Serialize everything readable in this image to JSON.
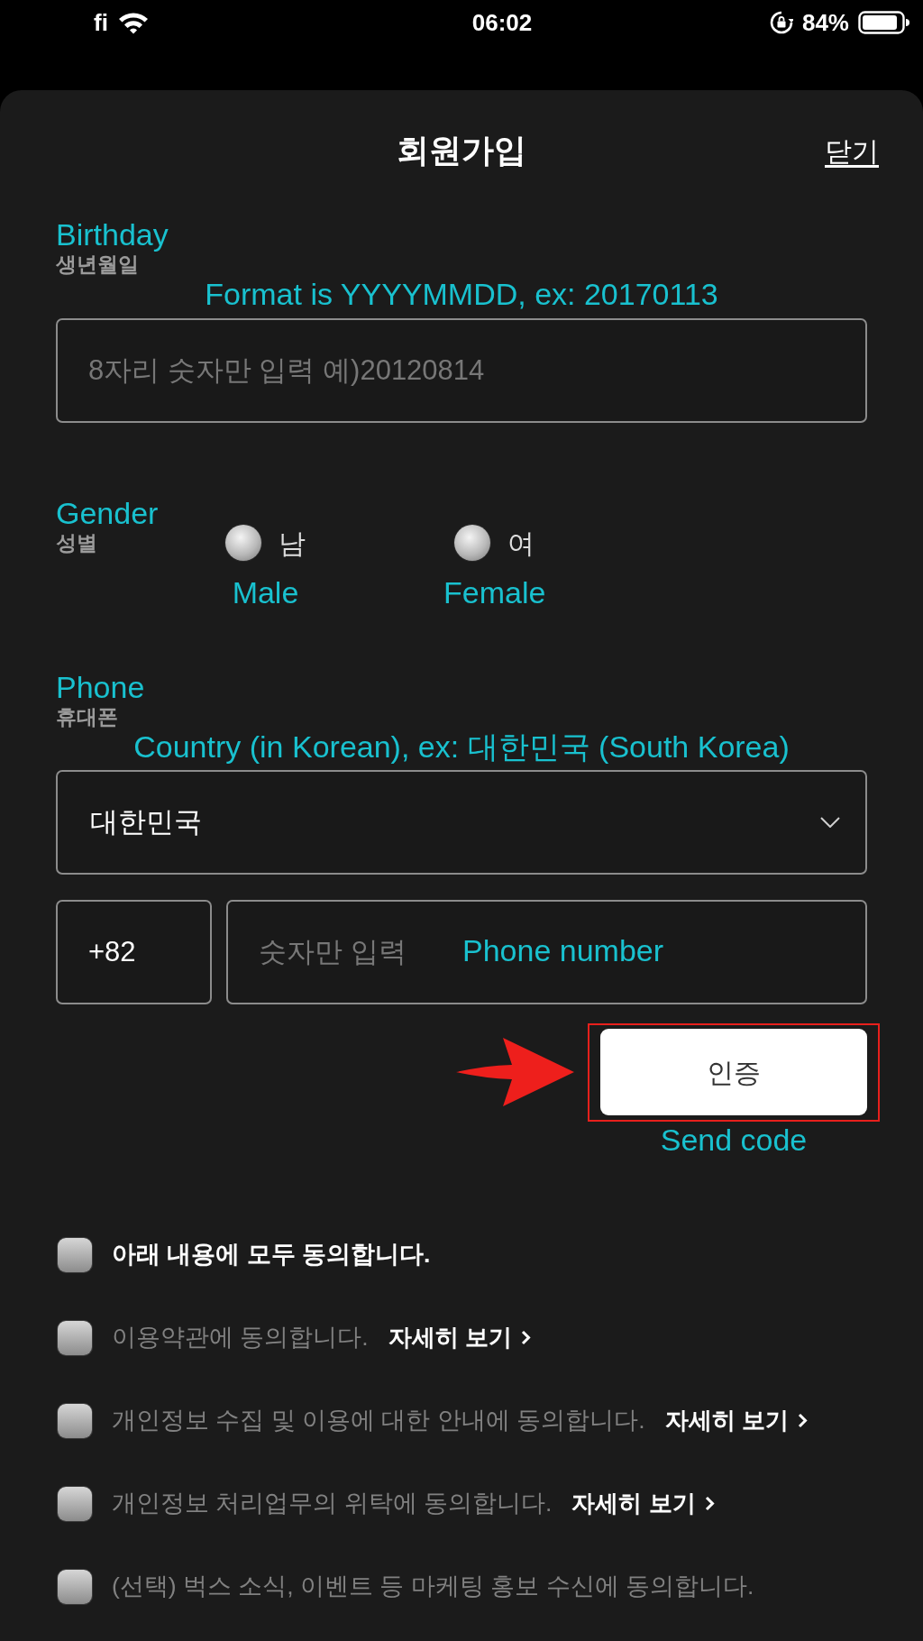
{
  "status_bar": {
    "carrier": "fi",
    "time": "06:02",
    "battery": "84%"
  },
  "sheet": {
    "title": "회원가입",
    "close": "닫기"
  },
  "birthday": {
    "annotation": "Birthday",
    "label": "생년월일",
    "format_annotation": "Format is YYYYMMDD, ex: 20170113",
    "placeholder": "8자리 숫자만 입력 예)20120814"
  },
  "gender": {
    "annotation": "Gender",
    "label": "성별",
    "options": [
      {
        "label": "남",
        "annotation": "Male",
        "selected": false
      },
      {
        "label": "여",
        "annotation": "Female",
        "selected": false
      }
    ]
  },
  "phone": {
    "annotation": "Phone",
    "label": "휴대폰",
    "country_annotation": "Country (in Korean), ex: 대한민국 (South Korea)",
    "country": "대한민국",
    "dial_code": "+82",
    "placeholder": "숫자만 입력",
    "number_annotation": "Phone number",
    "verify_button": {
      "label": "인증",
      "highlighted": true
    },
    "button_annotation": "Send code"
  },
  "agreements": [
    {
      "kind": "all",
      "text": "아래 내용에 모두 동의합니다.",
      "checked": false
    },
    {
      "kind": "item",
      "text": "이용약관에 동의합니다.",
      "link": "자세히 보기",
      "checked": false
    },
    {
      "kind": "item",
      "text": "개인정보 수집 및 이용에 대한 안내에 동의합니다.",
      "link": "자세히 보기",
      "checked": false
    },
    {
      "kind": "item",
      "text": "개인정보 처리업무의 위탁에 동의합니다.",
      "link": "자세히 보기",
      "checked": false
    },
    {
      "kind": "item",
      "text": "(선택) 벅스 소식, 이벤트 등 마케팅 홍보 수신에 동의합니다.",
      "checked": false
    }
  ]
}
